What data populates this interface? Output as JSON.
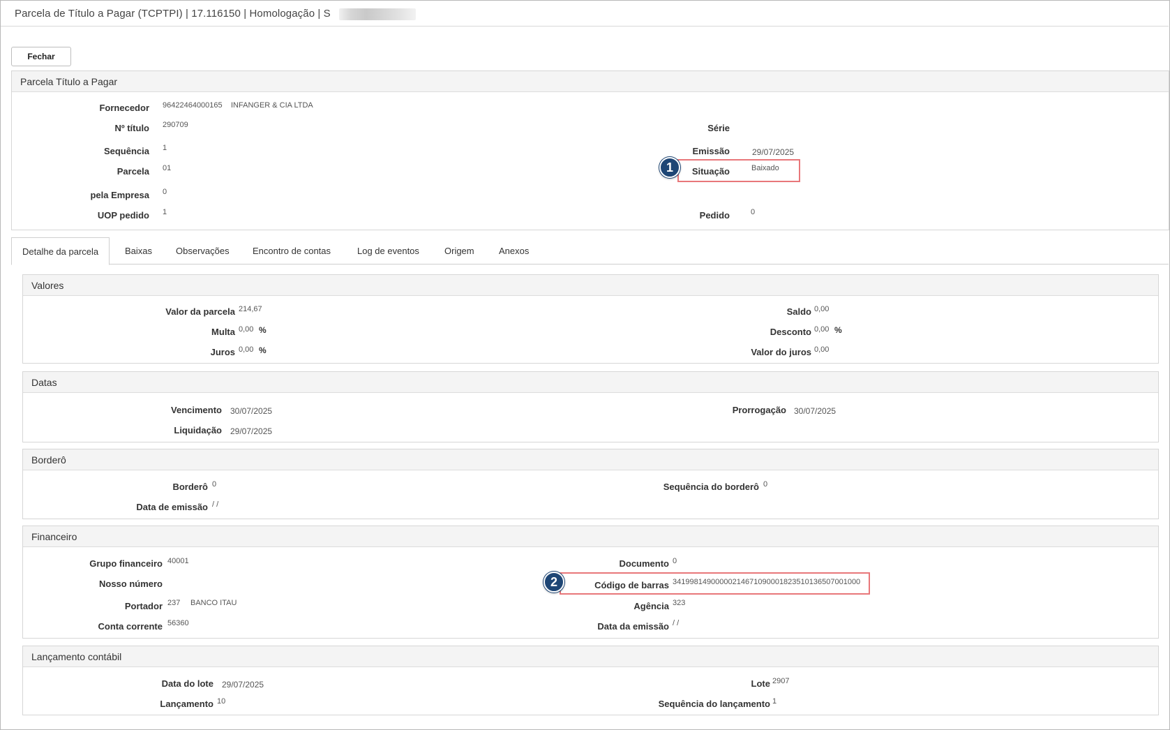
{
  "window": {
    "title": "Parcela de Título a Pagar (TCPTPI) | 17.116150 | Homologação | S"
  },
  "toolbar": {
    "close_label": "Fechar"
  },
  "parcela": {
    "heading": "Parcela Título a Pagar",
    "fornecedor_label": "Fornecedor",
    "fornecedor_code": "96422464000165",
    "fornecedor_name": "INFANGER & CIA LTDA",
    "titulo_label": "Nº título",
    "titulo_value": "290709",
    "serie_label": "Série",
    "sequencia_label": "Sequência",
    "sequencia_value": "1",
    "emissao_label": "Emissão",
    "emissao_value": "29/07/2025",
    "parcela_label": "Parcela",
    "parcela_value": "01",
    "situacao_label": "Situação",
    "situacao_value": "Baixado",
    "empresa_label": "pela Empresa",
    "empresa_value": "0",
    "uop_label": "UOP pedido",
    "uop_value": "1",
    "pedido_label": "Pedido",
    "pedido_value": "0"
  },
  "tabs": [
    "Detalhe da parcela",
    "Baixas",
    "Observações",
    "Encontro de contas",
    "Log de eventos",
    "Origem",
    "Anexos"
  ],
  "valores": {
    "heading": "Valores",
    "valor_parcela_label": "Valor da parcela",
    "valor_parcela_value": "214,67",
    "saldo_label": "Saldo",
    "saldo_value": "0,00",
    "multa_label": "Multa",
    "multa_value": "0,00",
    "desconto_label": "Desconto",
    "desconto_value": "0,00",
    "juros_label": "Juros",
    "juros_value": "0,00",
    "valor_juros_label": "Valor do juros",
    "valor_juros_value": "0,00",
    "percent_symbol": "%"
  },
  "datas": {
    "heading": "Datas",
    "vencimento_label": "Vencimento",
    "vencimento_value": "30/07/2025",
    "prorrogacao_label": "Prorrogação",
    "prorrogacao_value": "30/07/2025",
    "liquidacao_label": "Liquidação",
    "liquidacao_value": "29/07/2025"
  },
  "bordero": {
    "heading": "Borderô",
    "bordero_label": "Borderô",
    "bordero_value": "0",
    "seq_bordero_label": "Sequência do borderô",
    "seq_bordero_value": "0",
    "data_emissao_label": "Data de emissão",
    "data_emissao_value": "/ /"
  },
  "financeiro": {
    "heading": "Financeiro",
    "grupo_label": "Grupo financeiro",
    "grupo_value": "40001",
    "documento_label": "Documento",
    "documento_value": "0",
    "nosso_numero_label": "Nosso número",
    "codigo_barras_label": "Código de barras",
    "codigo_barras_value": "34199814900000214671090001823510136507001000",
    "portador_label": "Portador",
    "portador_code": "237",
    "portador_name": "BANCO ITAU",
    "agencia_label": "Agência",
    "agencia_value": "323",
    "conta_label": "Conta corrente",
    "conta_value": "56360",
    "data_emissao_label": "Data da emissão",
    "data_emissao_value": "/ /"
  },
  "lancamento": {
    "heading": "Lançamento contábil",
    "data_lote_label": "Data do lote",
    "data_lote_value": "29/07/2025",
    "lote_label": "Lote",
    "lote_value": "2907",
    "lancamento_label": "Lançamento",
    "lancamento_value": "10",
    "seq_lancamento_label": "Sequência do lançamento",
    "seq_lancamento_value": "1"
  },
  "annotations": {
    "badge1": "1",
    "badge2": "2",
    "highlight_color": "#e8777a",
    "badge_color": "#1e4675"
  }
}
